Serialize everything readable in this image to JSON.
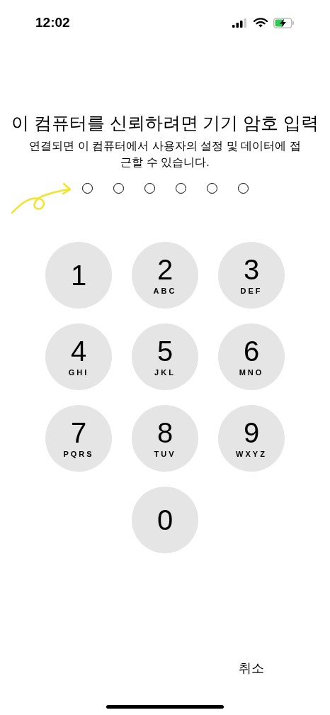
{
  "status_bar": {
    "time": "12:02"
  },
  "title": "이 컴퓨터를 신뢰하려면 기기 암호 입력",
  "subtitle": "연결되면 이 컴퓨터에서 사용자의 설정 및 데이터에 접근할 수 있습니다.",
  "passcode_dots": [
    {
      "filled": false
    },
    {
      "filled": false
    },
    {
      "filled": false
    },
    {
      "filled": false
    },
    {
      "filled": false
    },
    {
      "filled": false
    }
  ],
  "keypad": [
    {
      "digit": "1"
    },
    {
      "digit": "2",
      "letters": "ABC"
    },
    {
      "digit": "3",
      "letters": "DEF"
    },
    {
      "digit": "4",
      "letters": "GHI"
    },
    {
      "digit": "5",
      "letters": "JKL"
    },
    {
      "digit": "6",
      "letters": "MNO"
    },
    {
      "digit": "7",
      "letters": "PQRS"
    },
    {
      "digit": "8",
      "letters": "TUV"
    },
    {
      "digit": "9",
      "letters": "WXYZ"
    },
    {
      "digit": "0"
    }
  ],
  "cancel_button": "취소"
}
